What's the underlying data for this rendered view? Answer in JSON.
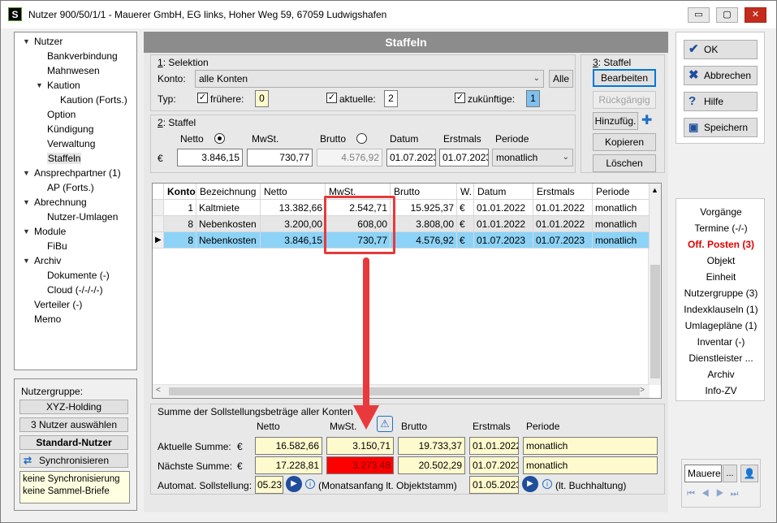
{
  "window": {
    "app_icon": "S",
    "title": "Nutzer 900/50/1/1 - Mauerer GmbH, EG links, Hoher Weg 59, 67059 Ludwigshafen",
    "buttons": {
      "minimize": "▭",
      "maximize": "▢",
      "close": "✕"
    }
  },
  "tree": [
    {
      "label": "Nutzer",
      "level": 0,
      "expander": "▼"
    },
    {
      "label": "Bankverbindung",
      "level": 1,
      "expander": ""
    },
    {
      "label": "Mahnwesen",
      "level": 1,
      "expander": ""
    },
    {
      "label": "Kaution",
      "level": 1,
      "expander": "▼"
    },
    {
      "label": "Kaution (Forts.)",
      "level": 2,
      "expander": ""
    },
    {
      "label": "Option",
      "level": 1,
      "expander": ""
    },
    {
      "label": "Kündigung",
      "level": 1,
      "expander": ""
    },
    {
      "label": "Verwaltung",
      "level": 1,
      "expander": ""
    },
    {
      "label": "Staffeln",
      "level": 1,
      "expander": "",
      "selected": true
    },
    {
      "label": "Ansprechpartner (1)",
      "level": 0,
      "expander": "▼"
    },
    {
      "label": "AP (Forts.)",
      "level": 1,
      "expander": ""
    },
    {
      "label": "Abrechnung",
      "level": 0,
      "expander": "▼"
    },
    {
      "label": "Nutzer-Umlagen",
      "level": 1,
      "expander": ""
    },
    {
      "label": "Module",
      "level": 0,
      "expander": "▼"
    },
    {
      "label": "FiBu",
      "level": 1,
      "expander": ""
    },
    {
      "label": "Archiv",
      "level": 0,
      "expander": "▼"
    },
    {
      "label": "Dokumente (-)",
      "level": 1,
      "expander": ""
    },
    {
      "label": "Cloud (-/-/-/-)",
      "level": 1,
      "expander": ""
    },
    {
      "label": "Verteiler (-)",
      "level": 0,
      "expander": ""
    },
    {
      "label": "Memo",
      "level": 0,
      "expander": ""
    }
  ],
  "left_lower": {
    "group_label": "Nutzergruppe:",
    "group_button": "XYZ-Holding",
    "select_button": "3 Nutzer auswählen",
    "standard_button": "Standard-Nutzer",
    "sync_button": "Synchronisieren",
    "note_line1": "keine Synchronisierung",
    "note_line2": "keine Sammel-Briefe"
  },
  "main": {
    "header": "Staffeln",
    "selektion": {
      "title_num": "1",
      "title": ": Selektion",
      "konto_label": "Konto:",
      "konto_value": "alle Konten",
      "alle_button": "Alle",
      "typ_label": "Typ:",
      "fruehere_label": "frühere:",
      "fruehere_value": "0",
      "aktuelle_label": "aktuelle:",
      "aktuelle_value": "2",
      "zukuenftige_label": "zukünftige:",
      "zukuenftige_value": "1"
    },
    "staffel_form": {
      "title_num": "2",
      "title": ": Staffel",
      "netto_label": "Netto",
      "mwst_label": "MwSt.",
      "brutto_label": "Brutto",
      "datum_label": "Datum",
      "erstmals_label": "Erstmals",
      "periode_label": "Periode",
      "currency": "€",
      "netto_value": "3.846,15",
      "mwst_value": "730,77",
      "brutto_value": "4.576,92",
      "datum_value": "01.07.2023",
      "erstmals_value": "01.07.2023",
      "periode_value": "monatlich"
    },
    "staffel_actions": {
      "title_num": "3",
      "title": ": Staffel",
      "edit": "Bearbeiten",
      "undo": "Rückgängig",
      "add": "Hinzufüg.",
      "add_icon": "✚",
      "copy": "Kopieren",
      "delete": "Löschen"
    },
    "table": {
      "columns": [
        "Konto",
        "Bezeichnung",
        "Netto",
        "MwSt.",
        "Brutto",
        "W.",
        "Datum",
        "Erstmals",
        "Periode"
      ],
      "rows": [
        {
          "indicator": "",
          "konto": "1",
          "bez": "Kaltmiete",
          "netto": "13.382,66",
          "mwst": "2.542,71",
          "brutto": "15.925,37",
          "w": "€",
          "datum": "01.01.2022",
          "erstmals": "01.01.2022",
          "periode": "monatlich"
        },
        {
          "indicator": "",
          "konto": "8",
          "bez": "Nebenkosten",
          "netto": "3.200,00",
          "mwst": "608,00",
          "brutto": "3.808,00",
          "w": "€",
          "datum": "01.01.2022",
          "erstmals": "01.01.2022",
          "periode": "monatlich"
        },
        {
          "indicator": "▶",
          "konto": "8",
          "bez": "Nebenkosten",
          "netto": "3.846,15",
          "mwst": "730,77",
          "brutto": "4.576,92",
          "w": "€",
          "datum": "01.07.2023",
          "erstmals": "01.07.2023",
          "periode": "monatlich"
        }
      ]
    },
    "summary": {
      "title": "Summe der Sollstellungsbeträge aller Konten",
      "netto_label": "Netto",
      "mwst_label": "MwSt.",
      "brutto_label": "Brutto",
      "erstmals_label": "Erstmals",
      "periode_label": "Periode",
      "warning_icon": "⚠",
      "aktuelle_label": "Aktuelle Summe:",
      "naechste_label": "Nächste Summe:",
      "currency": "€",
      "aktuelle": {
        "netto": "16.582,66",
        "mwst": "3.150,71",
        "brutto": "19.733,37",
        "erstmals": "01.01.2022",
        "periode": "monatlich"
      },
      "naechste": {
        "netto": "17.228,81",
        "mwst": "3.273,48",
        "brutto": "20.502,29",
        "erstmals": "01.07.2023",
        "periode": "monatlich"
      },
      "automat_label": "Automat. Sollstellung:",
      "automat_value": "05.23",
      "automat_note": "(Monatsanfang lt. Objektstamm)",
      "automat_date": "01.05.2023",
      "buchhaltung_note": "(lt. Buchhaltung)"
    }
  },
  "right": {
    "ok": "OK",
    "cancel": "Abbrechen",
    "help": "Hilfe",
    "save": "Speichern",
    "nav": [
      "Vorgänge",
      "Termine (-/-)",
      "Off. Posten (3)",
      "Objekt",
      "Einheit",
      "Nutzergruppe (3)",
      "Indexklauseln (1)",
      "Umlagepläne (1)",
      "Inventar (-)",
      "Dienstleister ...",
      "Archiv",
      "Info-ZV"
    ],
    "search_value": "Mauere",
    "search_btn": "..."
  },
  "colors": {
    "highlight": "#e8393c",
    "selected_row": "#8dd3f7",
    "warning_cell": "#ff0000",
    "input_yellow": "#fffacd"
  }
}
